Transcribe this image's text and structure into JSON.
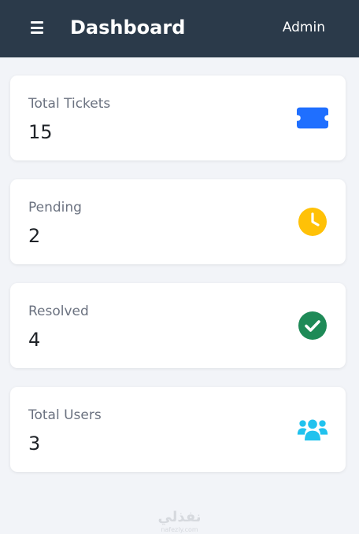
{
  "header": {
    "title": "Dashboard",
    "user_label": "Admin"
  },
  "cards": [
    {
      "label": "Total Tickets",
      "value": "15",
      "icon": "ticket-icon",
      "color": "#1f6fff"
    },
    {
      "label": "Pending",
      "value": "2",
      "icon": "clock-icon",
      "color": "#ffc107"
    },
    {
      "label": "Resolved",
      "value": "4",
      "icon": "check-circle-icon",
      "color": "#1e8a57"
    },
    {
      "label": "Total Users",
      "value": "3",
      "icon": "users-icon",
      "color": "#21c2ee"
    }
  ],
  "watermark": {
    "text": "نفذلي",
    "sub": "nafezly.com"
  },
  "colors": {
    "topbar": "#2b3a4a",
    "background": "#f2f4f8"
  }
}
